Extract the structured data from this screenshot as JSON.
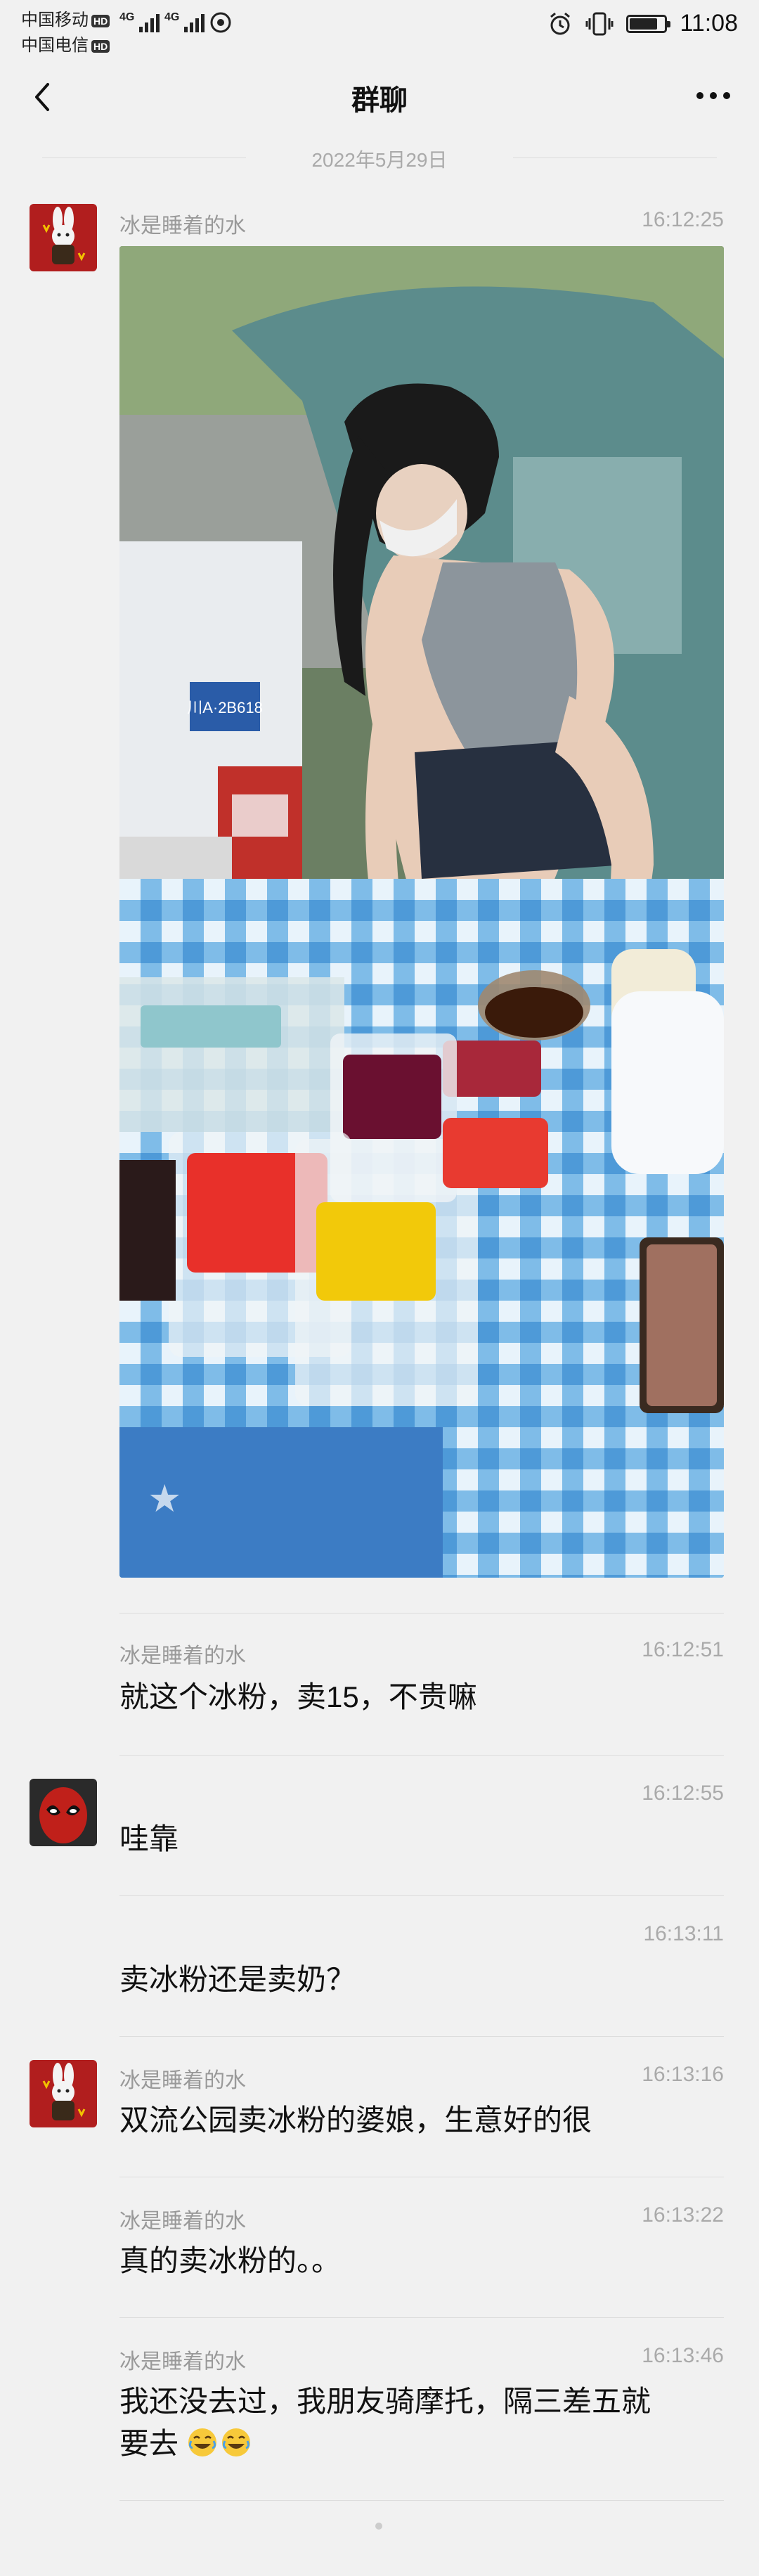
{
  "status_bar": {
    "carrier1": "中国移动",
    "carrier2": "中国电信",
    "hd_badge": "HD",
    "net1": "4G",
    "net2": "4G",
    "time": "11:08"
  },
  "header": {
    "title": "群聊",
    "back_icon": "chevron-left-icon",
    "more_icon": "more-dots-icon"
  },
  "date_separator": "2022年5月29日",
  "messages": [
    {
      "name": "冰是睡着的水",
      "time": "16:12:25",
      "type": "image"
    },
    {
      "name": "冰是睡着的水",
      "time": "16:12:51",
      "text": "就这个冰粉，卖15，不贵嘛"
    },
    {
      "name": "",
      "time": "16:12:55",
      "text": "哇靠"
    },
    {
      "name": "",
      "time": "16:13:11",
      "text": "卖冰粉还是卖奶？"
    },
    {
      "name": "冰是睡着的水",
      "time": "16:13:16",
      "text": "双流公园卖冰粉的婆娘，生意好的很"
    },
    {
      "name": "冰是睡着的水",
      "time": "16:13:22",
      "text": "真的卖冰粉的。。"
    },
    {
      "name": "冰是睡着的水",
      "time": "16:13:46",
      "text_line1": "我还没去过，我朋友骑摩托，隔三差五就",
      "text_line2": "要去"
    }
  ],
  "colors": {
    "background": "#f1f1f1",
    "tablecloth_blue": "#5aa6e0",
    "car_teal": "#5c8c8c"
  },
  "photo_text": {
    "plate": "川A·2B618"
  },
  "battery_level": 0.8
}
